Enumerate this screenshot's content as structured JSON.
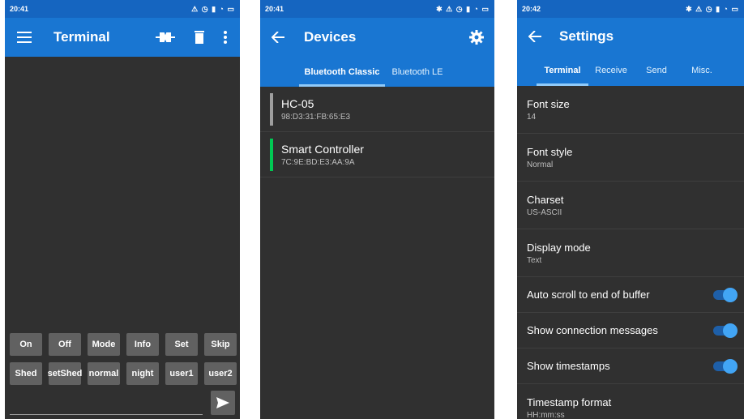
{
  "terminal": {
    "status_time": "20:41",
    "status_icons": "⚠ ◷ ▮ ◔ ▭",
    "title": "Terminal",
    "macros_row1": [
      "On",
      "Off",
      "Mode",
      "Info",
      "Set",
      "Skip"
    ],
    "macros_row2": [
      "Shed",
      "setShed",
      "normal",
      "night",
      "user1",
      "user2"
    ],
    "send_value": ""
  },
  "devices": {
    "status_time": "20:41",
    "status_icons": "✱ ⚠ ◷ ▮ ◔ ▭",
    "title": "Devices",
    "tabs": [
      "Bluetooth Classic",
      "Bluetooth LE"
    ],
    "list": [
      {
        "name": "HC-05",
        "address": "98:D3:31:FB:65:E3",
        "color": "#9e9e9e"
      },
      {
        "name": "Smart Controller",
        "address": "7C:9E:BD:E3:AA:9A",
        "color": "#00c853"
      }
    ]
  },
  "settings": {
    "status_time": "20:42",
    "status_icons": "✱ ⚠ ◷ ▮ ◔ ▭",
    "title": "Settings",
    "tabs": [
      "Terminal",
      "Receive",
      "Send",
      "Misc."
    ],
    "items": [
      {
        "label": "Font size",
        "value": "14"
      },
      {
        "label": "Font style",
        "value": "Normal"
      },
      {
        "label": "Charset",
        "value": "US-ASCII"
      },
      {
        "label": "Display mode",
        "value": "Text"
      }
    ],
    "toggles": [
      {
        "label": "Auto scroll to end of buffer",
        "on": true
      },
      {
        "label": "Show connection messages",
        "on": true
      },
      {
        "label": "Show timestamps",
        "on": true
      }
    ],
    "last_item": {
      "label": "Timestamp format",
      "value": "HH:mm:ss"
    }
  }
}
